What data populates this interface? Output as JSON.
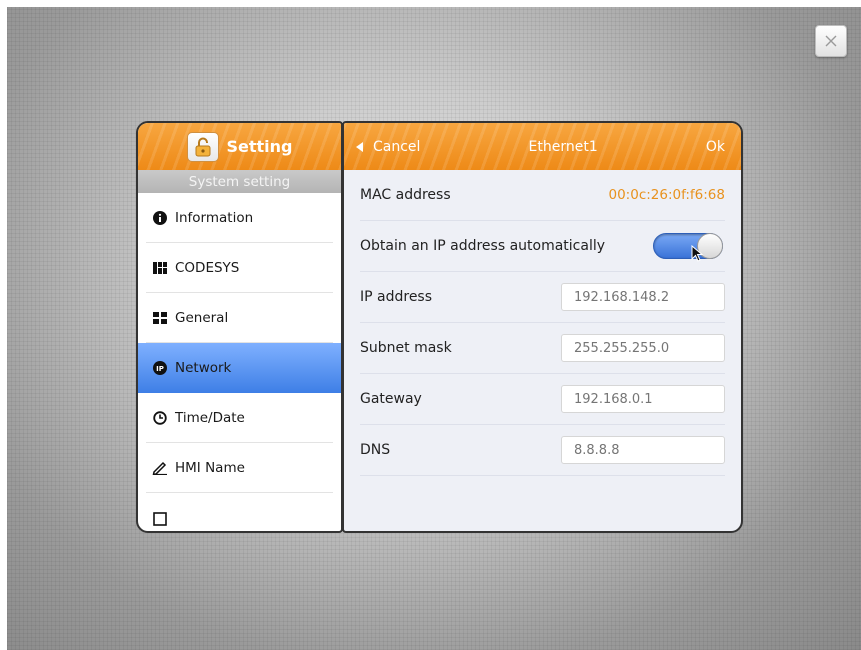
{
  "left_panel": {
    "title": "Setting",
    "subheader": "System setting",
    "menu": [
      {
        "label": "Information",
        "icon": "info-icon"
      },
      {
        "label": "CODESYS",
        "icon": "codesys-icon"
      },
      {
        "label": "General",
        "icon": "grid-icon"
      },
      {
        "label": "Network",
        "icon": "ip-icon",
        "active": true
      },
      {
        "label": "Time/Date",
        "icon": "clock-icon"
      },
      {
        "label": "HMI Name",
        "icon": "pen-icon"
      }
    ]
  },
  "right_panel": {
    "cancel_label": "Cancel",
    "title": "Ethernet1",
    "ok_label": "Ok",
    "mac": {
      "label": "MAC address",
      "value": "00:0c:26:0f:f6:68"
    },
    "dhcp": {
      "label": "Obtain an IP address automatically",
      "enabled": true
    },
    "ip": {
      "label": "IP address",
      "placeholder": "192.168.148.2"
    },
    "subnet": {
      "label": "Subnet mask",
      "placeholder": "255.255.255.0"
    },
    "gateway": {
      "label": "Gateway",
      "placeholder": "192.168.0.1"
    },
    "dns": {
      "label": "DNS",
      "placeholder": "8.8.8.8"
    }
  },
  "colors": {
    "accent_orange": "#ee8a17",
    "active_blue": "#3e7fe6",
    "mac_text": "#e8921e"
  }
}
